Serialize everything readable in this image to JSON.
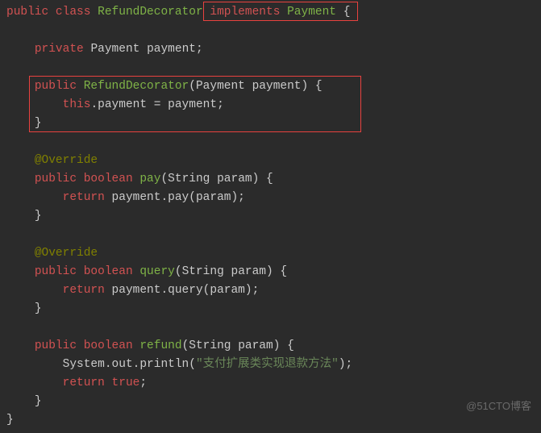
{
  "code": {
    "l1": {
      "kw1": "public",
      "kw2": "class",
      "name": "RefundDecorator",
      "impl": "implements",
      "type": "Payment",
      "brace": "{"
    },
    "l3": {
      "kw": "private",
      "type": "Payment",
      "id": "payment",
      "semi": ";"
    },
    "l5": {
      "kw": "public",
      "name": "RefundDecorator",
      "p1": "(",
      "ptype": "Payment",
      "pid": "payment",
      "p2": ") {"
    },
    "l6": {
      "kw": "this",
      "dot": ".payment = payment;"
    },
    "l7": {
      "brace": "}"
    },
    "l9": {
      "ann": "@Override"
    },
    "l10": {
      "kw": "public",
      "ret": "boolean",
      "name": "pay",
      "p1": "(",
      "ptype": "String",
      "pid": "param",
      "p2": ") {"
    },
    "l11": {
      "kw": "return",
      "rest": " payment.pay(param);"
    },
    "l12": {
      "brace": "}"
    },
    "l14": {
      "ann": "@Override"
    },
    "l15": {
      "kw": "public",
      "ret": "boolean",
      "name": "query",
      "p1": "(",
      "ptype": "String",
      "pid": "param",
      "p2": ") {"
    },
    "l16": {
      "kw": "return",
      "rest": " payment.query(param);"
    },
    "l17": {
      "brace": "}"
    },
    "l19": {
      "kw": "public",
      "ret": "boolean",
      "name": "refund",
      "p1": "(",
      "ptype": "String",
      "pid": "param",
      "p2": ") {"
    },
    "l20": {
      "text1": "System.out.println(",
      "str": "\"支付扩展类实现退款方法\"",
      "text2": ");"
    },
    "l21": {
      "kw": "return",
      "val": "true",
      "semi": ";"
    },
    "l22": {
      "brace": "}"
    },
    "l23": {
      "brace": "}"
    }
  },
  "watermark": "@51CTO博客"
}
